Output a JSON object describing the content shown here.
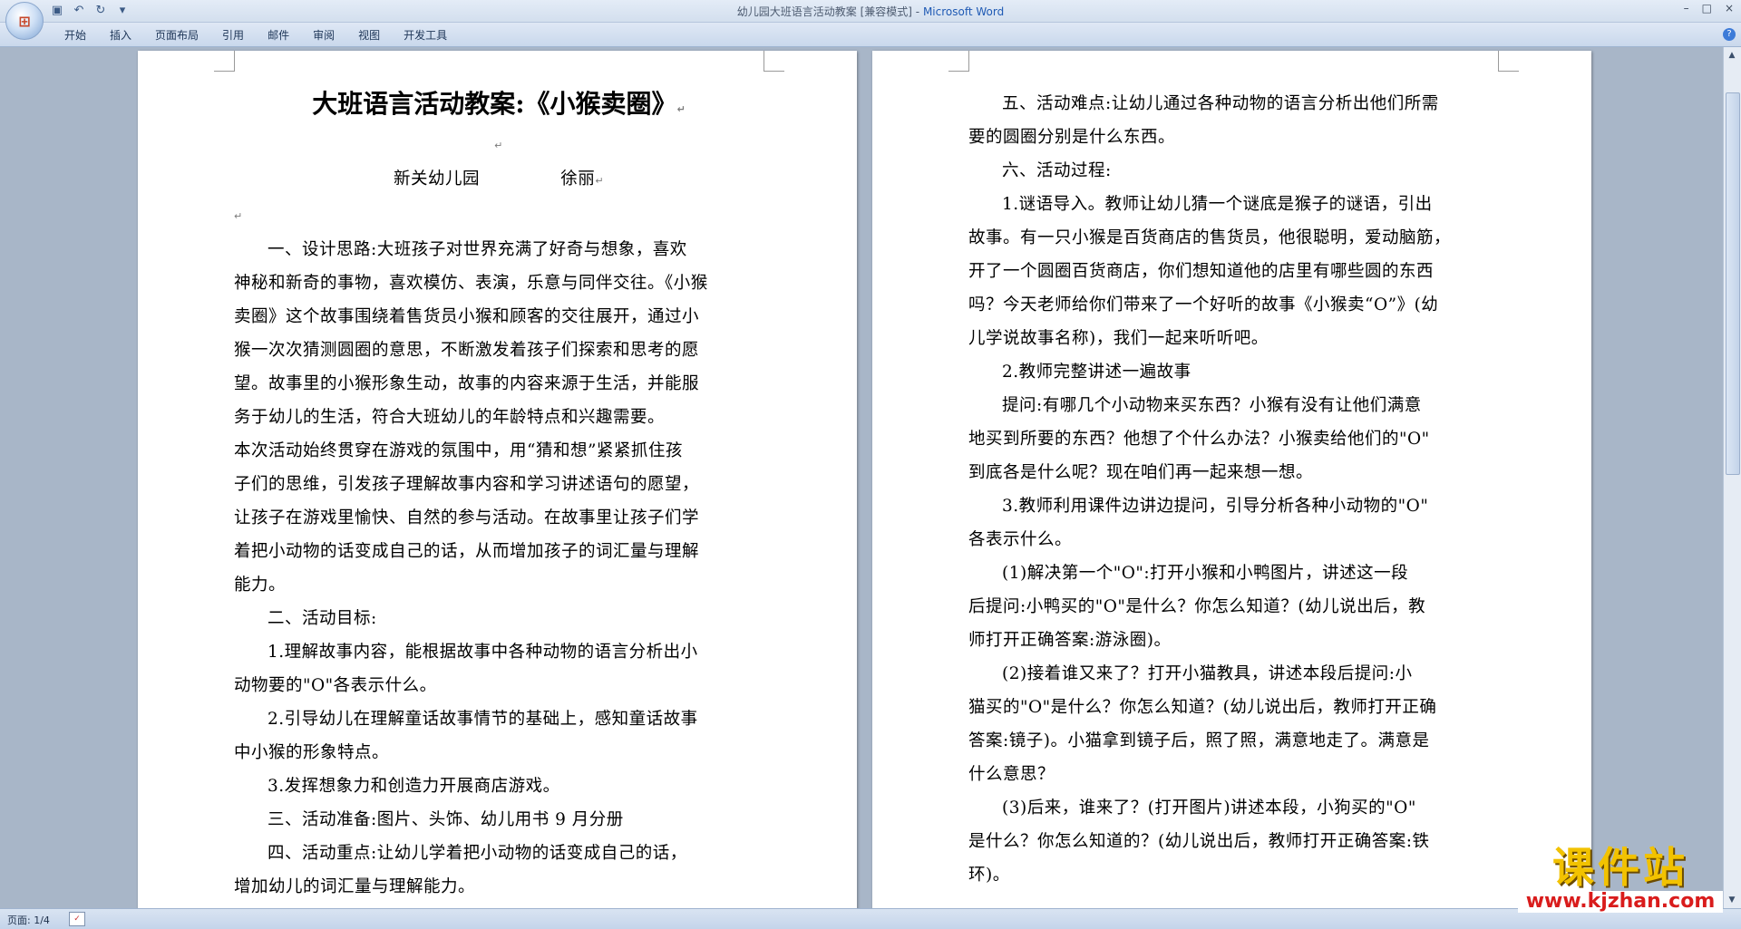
{
  "window": {
    "title": "幼儿园大班语言活动教案 [兼容模式]",
    "app_name": "Microsoft Word",
    "controls": [
      "–",
      "□",
      "×"
    ]
  },
  "ribbon": {
    "tabs": [
      "开始",
      "插入",
      "页面布局",
      "引用",
      "邮件",
      "审阅",
      "视图",
      "开发工具"
    ]
  },
  "page1": {
    "title": "大班语言活动教案:《小猴卖圈》",
    "author_line": "新关幼儿园              徐丽",
    "lines": [
      {
        "text": "一、设计思路:大班孩子对世界充满了好奇与想象，喜欢",
        "indent": true
      },
      {
        "text": "神秘和新奇的事物，喜欢模仿、表演，乐意与同伴交往。《小猴",
        "indent": false
      },
      {
        "text": "卖圈》这个故事围绕着售货员小猴和顾客的交往展开，通过小",
        "indent": false
      },
      {
        "text": "猴一次次猜测圆圈的意思，不断激发着孩子们探索和思考的愿",
        "indent": false
      },
      {
        "text": "望。故事里的小猴形象生动，故事的内容来源于生活，并能服",
        "indent": false
      },
      {
        "text": "务于幼儿的生活，符合大班幼儿的年龄特点和兴趣需要。",
        "indent": false
      },
      {
        "text": "本次活动始终贯穿在游戏的氛围中，用“猜和想”紧紧抓住孩",
        "indent": false
      },
      {
        "text": "子们的思维，引发孩子理解故事内容和学习讲述语句的愿望，",
        "indent": false
      },
      {
        "text": "让孩子在游戏里愉快、自然的参与活动。在故事里让孩子们学",
        "indent": false
      },
      {
        "text": "着把小动物的话变成自己的话，从而增加孩子的词汇量与理解",
        "indent": false
      },
      {
        "text": "能力。",
        "indent": false
      },
      {
        "text": "二、活动目标:",
        "indent": true
      },
      {
        "text": "1.理解故事内容，能根据故事中各种动物的语言分析出小",
        "indent": true
      },
      {
        "text": "动物要的\"O\"各表示什么。",
        "indent": false
      },
      {
        "text": "2.引导幼儿在理解童话故事情节的基础上，感知童话故事",
        "indent": true
      },
      {
        "text": "中小猴的形象特点。",
        "indent": false
      },
      {
        "text": "3.发挥想象力和创造力开展商店游戏。",
        "indent": true
      },
      {
        "text": "三、活动准备:图片、头饰、幼儿用书 9 月分册",
        "indent": true
      },
      {
        "text": "四、活动重点:让幼儿学着把小动物的话变成自己的话，",
        "indent": true
      },
      {
        "text": "增加幼儿的词汇量与理解能力。",
        "indent": false
      }
    ]
  },
  "page2": {
    "lines": [
      {
        "text": "五、活动难点:让幼儿通过各种动物的语言分析出他们所需",
        "indent": true
      },
      {
        "text": "要的圆圈分别是什么东西。",
        "indent": false
      },
      {
        "text": "六、活动过程:",
        "indent": true
      },
      {
        "text": "1.谜语导入。教师让幼儿猜一个谜底是猴子的谜语，引出",
        "indent": true
      },
      {
        "text": "故事。有一只小猴是百货商店的售货员，他很聪明，爱动脑筋，",
        "indent": false
      },
      {
        "text": "开了一个圆圈百货商店，你们想知道他的店里有哪些圆的东西",
        "indent": false
      },
      {
        "text": "吗？今天老师给你们带来了一个好听的故事《小猴卖“O”》(幼",
        "indent": false
      },
      {
        "text": "儿学说故事名称)，我们一起来听听吧。",
        "indent": false
      },
      {
        "text": "2.教师完整讲述一遍故事",
        "indent": true
      },
      {
        "text": "提问:有哪几个小动物来买东西？小猴有没有让他们满意",
        "indent": true
      },
      {
        "text": "地买到所要的东西？他想了个什么办法？小猴卖给他们的\"O\"",
        "indent": false
      },
      {
        "text": "到底各是什么呢？现在咱们再一起来想一想。",
        "indent": false
      },
      {
        "text": "3.教师利用课件边讲边提问，引导分析各种小动物的\"O\"",
        "indent": true
      },
      {
        "text": "各表示什么。",
        "indent": false
      },
      {
        "text": "(1)解决第一个\"O\":打开小猴和小鸭图片，讲述这一段",
        "indent": true
      },
      {
        "text": "后提问:小鸭买的\"O\"是什么？你怎么知道？(幼儿说出后，教",
        "indent": false
      },
      {
        "text": "师打开正确答案:游泳圈)。",
        "indent": false
      },
      {
        "text": "(2)接着谁又来了？打开小猫教具，讲述本段后提问:小",
        "indent": true
      },
      {
        "text": "猫买的\"O\"是什么？你怎么知道？(幼儿说出后，教师打开正确",
        "indent": false
      },
      {
        "text": "答案:镜子)。小猫拿到镜子后，照了照，满意地走了。满意是",
        "indent": false
      },
      {
        "text": "什么意思？",
        "indent": false
      },
      {
        "text": "(3)后来，谁来了？(打开图片)讲述本段，小狗买的\"O\"",
        "indent": true
      },
      {
        "text": "是什么？你怎么知道的？(幼儿说出后，教师打开正确答案:铁",
        "indent": false
      },
      {
        "text": "环)。",
        "indent": false
      }
    ]
  },
  "status": {
    "page_info": "页面: 1/4"
  },
  "watermark": {
    "top": "课件站",
    "bottom": "www.kjzhan.com"
  }
}
